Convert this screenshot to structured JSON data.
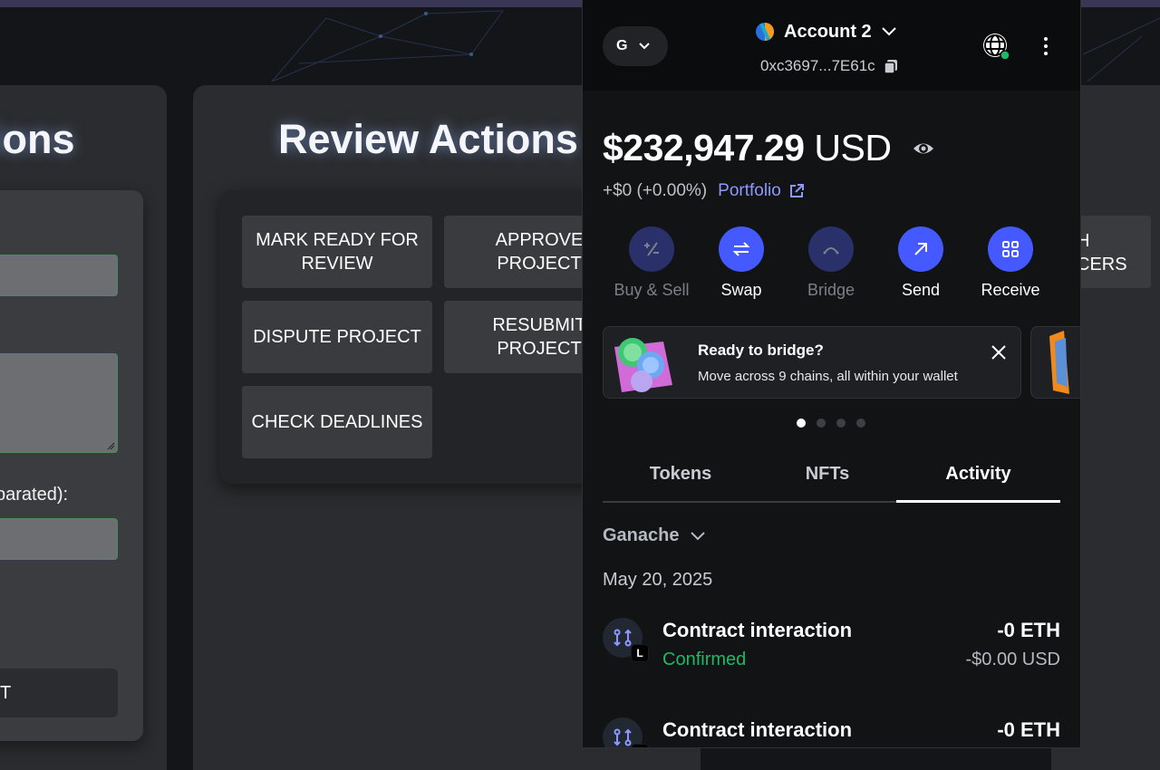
{
  "dapp": {
    "left_panel": {
      "title_fragment": "ions",
      "field_label_fragment": "parated):",
      "submit_fragment": "T"
    },
    "review": {
      "title": "Review Actions",
      "buttons": [
        "MARK READY FOR REVIEW",
        "APPROVE PROJECT",
        "DISPUTE PROJECT",
        "RESUBMIT PROJECT",
        "CHECK DEADLINES"
      ]
    },
    "right_panel": {
      "button_line1": "H",
      "button_line2": "CERS"
    }
  },
  "wallet": {
    "network_letter": "G",
    "account_name": "Account 2",
    "address": "0xc3697...7E61c",
    "balance_amount": "$232,947.29",
    "balance_currency": "USD",
    "change": "+$0 (+0.00%)",
    "portfolio_label": "Portfolio",
    "actions": [
      {
        "label": "Buy & Sell",
        "icon": "buy-sell-icon",
        "enabled": false
      },
      {
        "label": "Swap",
        "icon": "swap-icon",
        "enabled": true
      },
      {
        "label": "Bridge",
        "icon": "bridge-icon",
        "enabled": false
      },
      {
        "label": "Send",
        "icon": "send-arrow-icon",
        "enabled": true
      },
      {
        "label": "Receive",
        "icon": "receive-qr-icon",
        "enabled": true
      }
    ],
    "banner": {
      "title": "Ready to bridge?",
      "subtitle": "Move across 9 chains, all within your wallet"
    },
    "carousel": {
      "total": 4,
      "active": 1
    },
    "tabs": [
      "Tokens",
      "NFTs",
      "Activity"
    ],
    "active_tab": "Activity",
    "network_filter": "Ganache",
    "date_header": "May 20, 2025",
    "transactions": [
      {
        "title": "Contract interaction",
        "status": "Confirmed",
        "amount": "-0 ETH",
        "fiat": "-$0.00 USD",
        "badge": "L"
      },
      {
        "title": "Contract interaction",
        "status": "",
        "amount": "-0 ETH",
        "fiat": "",
        "badge": "L"
      }
    ],
    "colors": {
      "accent": "#4459ff",
      "link": "#8b99ff",
      "success": "#1fb866"
    }
  }
}
